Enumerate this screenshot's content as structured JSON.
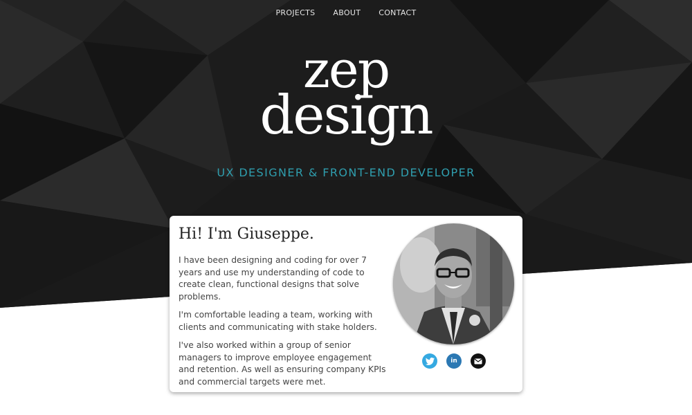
{
  "nav": {
    "items": [
      {
        "label": "PROJECTS"
      },
      {
        "label": "ABOUT"
      },
      {
        "label": "CONTACT"
      }
    ]
  },
  "logo": {
    "line1": "zep",
    "line2": "design"
  },
  "tagline": "UX DESIGNER & FRONT-END DEVELOPER",
  "intro": {
    "heading": "Hi! I'm Giuseppe.",
    "paragraphs": [
      "I have been designing and coding for over 7 years and use my understanding of code to create clean, functional designs that solve problems.",
      "I'm comfortable leading a team, working with clients and communicating with stake holders.",
      "I've also worked within a group of senior managers to improve employee engagement and retention. As well as ensuring company KPIs and commercial targets were met."
    ]
  },
  "social": {
    "twitter_icon": "twitter-bird-icon",
    "linkedin_icon": "linkedin-in-icon",
    "linkedin_glyph": "in",
    "email_icon": "envelope-icon"
  },
  "colors": {
    "hero_background": "#1c1c1c",
    "tagline": "#2f9eae",
    "twitter": "#35a9e1",
    "linkedin": "#2b78b3",
    "email": "#111111"
  }
}
